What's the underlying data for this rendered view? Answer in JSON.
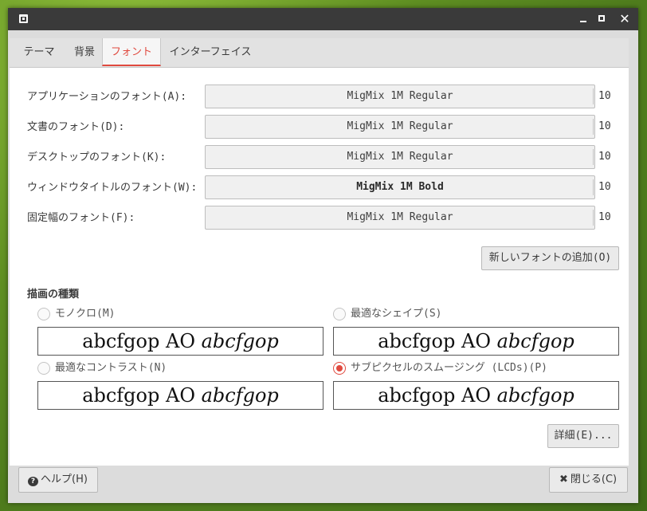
{
  "window": {
    "tabs": [
      "テーマ",
      "背景",
      "フォント",
      "インターフェイス"
    ],
    "active_tab": "フォント"
  },
  "fonts": [
    {
      "label": "アプリケーションのフォント(A):",
      "name": "MigMix 1M Regular",
      "size": "10"
    },
    {
      "label": "文書のフォント(D):",
      "name": "MigMix 1M Regular",
      "size": "10"
    },
    {
      "label": "デスクトップのフォント(K):",
      "name": "MigMix 1M Regular",
      "size": "10"
    },
    {
      "label": "ウィンドウタイトルのフォント(W):",
      "name": "MigMix 1M Bold",
      "size": "10"
    },
    {
      "label": "固定幅のフォント(F):",
      "name": "MigMix 1M Regular",
      "size": "10"
    }
  ],
  "add_font_button": "新しいフォントの追加(O)",
  "rendering": {
    "title": "描画の種類",
    "options": [
      {
        "label": "モノクロ(M)",
        "checked": false
      },
      {
        "label": "最適なシェイプ(S)",
        "checked": false
      },
      {
        "label": "最適なコントラスト(N)",
        "checked": false
      },
      {
        "label": "サブピクセルのスムージング (LCDs)(P)",
        "checked": true
      }
    ],
    "sample_regular": "abcfgop AO ",
    "sample_italic": "abcfgop"
  },
  "details_button": "詳細(E)...",
  "help_button": "ヘルプ(H)",
  "close_button": "閉じる(C)",
  "icons": {
    "help": "help-icon",
    "close": "close-icon"
  },
  "colors": {
    "accent": "#e04a3f",
    "titlebar": "#3a3a3a"
  }
}
